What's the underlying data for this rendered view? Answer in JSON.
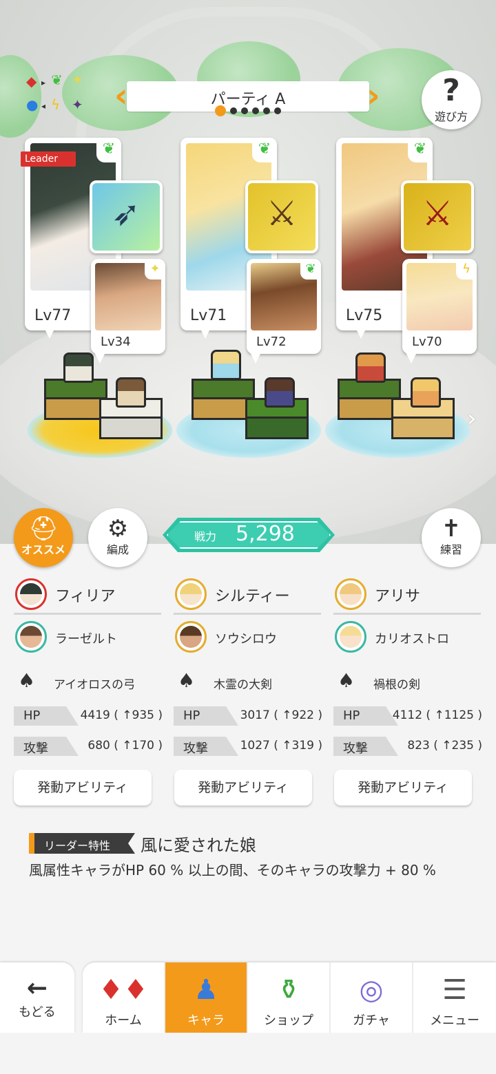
{
  "header": {
    "party_title": "パーティ A",
    "party_page_count": 6,
    "party_page_active": 0,
    "help_label": "遊び方"
  },
  "element_chart": {
    "icons": [
      "diamond-red",
      "leaf-green",
      "sparkle-yellow",
      "circle-blue",
      "bolt-yellow",
      "star-purple"
    ]
  },
  "party": [
    {
      "leader_tag": "Leader",
      "main_level": "Lv77",
      "main_attribute": "wind-leaf-icon",
      "weapon_icon": "bow-icon",
      "sub_level": "Lv34",
      "sub_attribute": "light-sparkle-icon"
    },
    {
      "leader_tag": "",
      "main_level": "Lv71",
      "main_attribute": "wind-leaf-icon",
      "weapon_icon": "greatsword-icon",
      "sub_level": "Lv72",
      "sub_attribute": "wind-leaf-icon"
    },
    {
      "leader_tag": "",
      "main_level": "Lv75",
      "main_attribute": "wind-leaf-icon",
      "weapon_icon": "red-sword-icon",
      "sub_level": "Lv70",
      "sub_attribute": "thunder-bolt-icon"
    }
  ],
  "actions": {
    "recommend_label": "オススメ",
    "formation_label": "編成",
    "practice_label": "練習"
  },
  "power": {
    "label": "戦力",
    "value": "5,298"
  },
  "members": [
    {
      "main_name": "フィリア",
      "sub_name": "ラーゼルト",
      "weapon_name": "アイオロスの弓",
      "hp_label": "HP",
      "hp_value": "4419 ( ↑935 )",
      "atk_label": "攻撃",
      "atk_value": "680 ( ↑170 )",
      "ability_label": "発動アビリティ"
    },
    {
      "main_name": "シルティー",
      "sub_name": "ソウシロウ",
      "weapon_name": "木霊の大剣",
      "hp_label": "HP",
      "hp_value": "3017 ( ↑922 )",
      "atk_label": "攻撃",
      "atk_value": "1027 ( ↑319 )",
      "ability_label": "発動アビリティ"
    },
    {
      "main_name": "アリサ",
      "sub_name": "カリオストロ",
      "weapon_name": "禍根の剣",
      "hp_label": "HP",
      "hp_value": "4112 ( ↑1125 )",
      "atk_label": "攻撃",
      "atk_value": "823 ( ↑235 )",
      "ability_label": "発動アビリティ"
    }
  ],
  "leader_trait": {
    "tag": "リーダー特性",
    "name": "風に愛された娘",
    "description": "風属性キャラがHP 60 % 以上の間、そのキャラの攻撃力 + 80 %"
  },
  "nav": {
    "back_label": "もどる",
    "tabs": [
      {
        "label": "ホーム",
        "icon": "home-icon",
        "active": false
      },
      {
        "label": "キャラ",
        "icon": "chara-icon",
        "active": true
      },
      {
        "label": "ショップ",
        "icon": "shop-icon",
        "active": false
      },
      {
        "label": "ガチャ",
        "icon": "gacha-icon",
        "active": false
      },
      {
        "label": "メニュー",
        "icon": "menu-icon",
        "active": false
      }
    ]
  },
  "colors": {
    "accent": "#f39a1a",
    "power": "#2ec2a4",
    "leader_red": "#d9322e",
    "wind_green": "#3fbf3f"
  }
}
